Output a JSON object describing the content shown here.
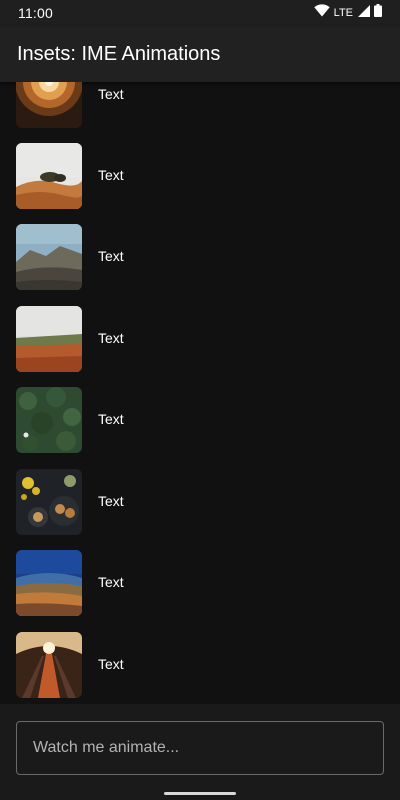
{
  "status_bar": {
    "time": "11:00",
    "network": "LTE",
    "icons": [
      "wifi-icon",
      "cell-signal-icon",
      "battery-icon"
    ]
  },
  "app_bar": {
    "title": "Insets: IME Animations"
  },
  "list": {
    "items": [
      {
        "label": "Text",
        "image": "dome-ceiling-photo"
      },
      {
        "label": "Text",
        "image": "desert-trees-photo"
      },
      {
        "label": "Text",
        "image": "volcano-landscape-photo"
      },
      {
        "label": "Text",
        "image": "autumn-field-photo"
      },
      {
        "label": "Text",
        "image": "forest-aerial-photo"
      },
      {
        "label": "Text",
        "image": "food-table-photo"
      },
      {
        "label": "Text",
        "image": "panoramic-valley-photo"
      },
      {
        "label": "Text",
        "image": "escalator-tunnel-photo"
      }
    ]
  },
  "input": {
    "placeholder": "Watch me animate..."
  },
  "colors": {
    "background": "#121112",
    "app_bar": "#212121",
    "status_bar": "#1f1f1f"
  }
}
